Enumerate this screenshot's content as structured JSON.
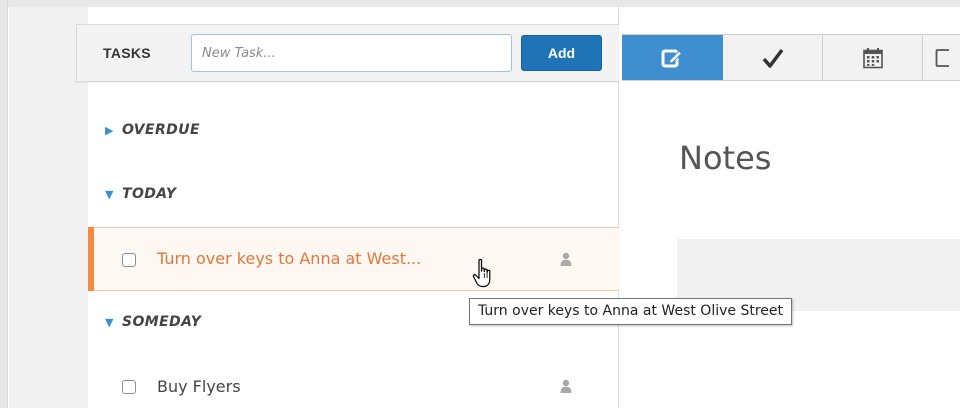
{
  "toolbar": {
    "label": "TASKS",
    "new_task_placeholder": "New Task...",
    "add_label": "Add"
  },
  "sections": {
    "overdue": "OVERDUE",
    "today": "TODAY",
    "someday": "SOMEDAY"
  },
  "tasks": {
    "today": [
      {
        "text": "Turn over keys to Anna at West...",
        "selected": true
      }
    ],
    "someday": [
      {
        "text": "Buy Flyers",
        "selected": false
      }
    ]
  },
  "tooltip": "Turn over keys to Anna at West Olive Street",
  "tabs": [
    {
      "icon": "edit-icon",
      "active": true
    },
    {
      "icon": "checkmark-icon",
      "active": false
    },
    {
      "icon": "calendar-icon",
      "active": false
    },
    {
      "icon": "partial-icon",
      "active": false
    }
  ],
  "notes": {
    "title": "Notes"
  },
  "colors": {
    "accent_blue": "#3e8ed0",
    "add_button": "#1f73b7",
    "selected_accent": "#f28a40",
    "selected_text": "#e0783a"
  }
}
